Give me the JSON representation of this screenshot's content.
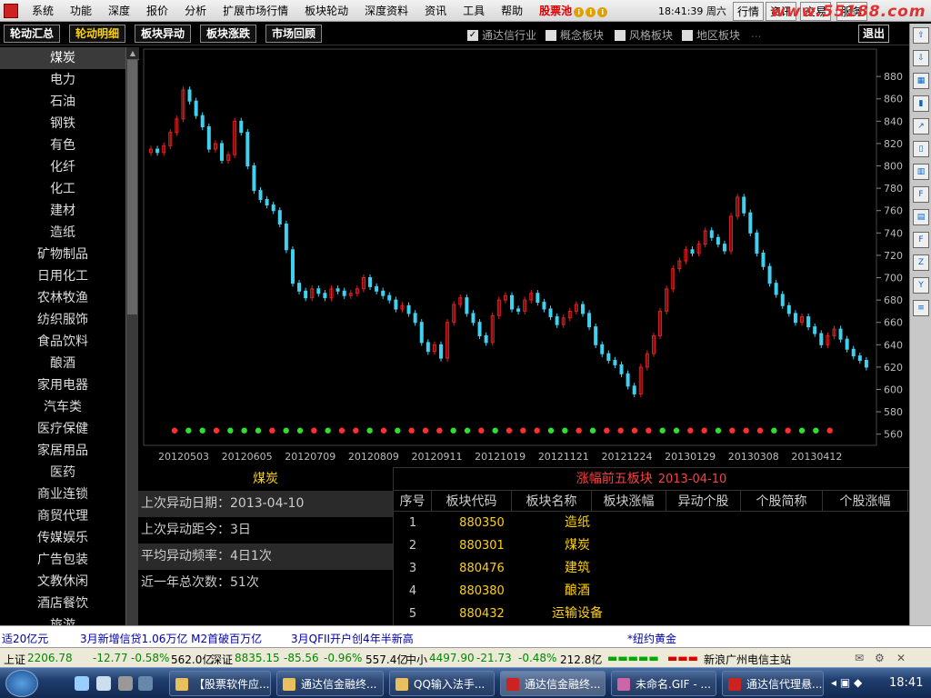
{
  "menubar": {
    "items": [
      "系统",
      "功能",
      "深度",
      "报价",
      "分析",
      "扩展市场行情",
      "板块轮动",
      "深度资料",
      "资讯",
      "工具",
      "帮助"
    ],
    "stock_pool": "股票池",
    "clock": "18:41:39 周六",
    "right_buttons": [
      "行情",
      "资讯",
      "交易",
      "服务"
    ],
    "watermark": "www.55188.com"
  },
  "tabs": [
    "轮动汇总",
    "轮动明细",
    "板块异动",
    "板块涨跌",
    "市场回顾"
  ],
  "active_tab": 1,
  "filters": [
    {
      "label": "通达信行业",
      "checked": true
    },
    {
      "label": "概念板块",
      "checked": false
    },
    {
      "label": "风格板块",
      "checked": false
    },
    {
      "label": "地区板块",
      "checked": false
    }
  ],
  "filter_extra": "...",
  "exit_label": "退出",
  "sidebar": {
    "items": [
      "煤炭",
      "电力",
      "石油",
      "钢铁",
      "有色",
      "化纤",
      "化工",
      "建材",
      "造纸",
      "矿物制品",
      "日用化工",
      "农林牧渔",
      "纺织服饰",
      "食品饮料",
      "酿酒",
      "家用电器",
      "汽车类",
      "医疗保健",
      "家居用品",
      "医药",
      "商业连锁",
      "商贸代理",
      "传媒娱乐",
      "广告包装",
      "文教休闲",
      "酒店餐饮",
      "旅游"
    ],
    "selected": 0
  },
  "chart_data": {
    "type": "candlestick",
    "title": "",
    "ylim": [
      550,
      885
    ],
    "yticks": [
      880,
      860,
      840,
      820,
      800,
      780,
      760,
      740,
      720,
      700,
      680,
      660,
      640,
      620,
      600,
      580,
      560
    ],
    "xticks": [
      "20120503",
      "20120605",
      "20120709",
      "20120809",
      "20120911",
      "20121019",
      "20121121",
      "20121224",
      "20130129",
      "20130308",
      "20130412"
    ],
    "close_path": [
      815,
      812,
      818,
      830,
      842,
      868,
      858,
      845,
      835,
      815,
      820,
      805,
      810,
      840,
      830,
      800,
      778,
      770,
      765,
      760,
      748,
      725,
      695,
      688,
      682,
      690,
      686,
      682,
      690,
      688,
      684,
      686,
      690,
      700,
      692,
      688,
      684,
      680,
      672,
      675,
      668,
      660,
      642,
      634,
      640,
      628,
      660,
      676,
      682,
      668,
      660,
      648,
      642,
      666,
      680,
      684,
      672,
      670,
      680,
      686,
      678,
      672,
      665,
      658,
      664,
      670,
      676,
      668,
      656,
      640,
      632,
      626,
      622,
      614,
      603,
      596,
      620,
      632,
      648,
      670,
      690,
      708,
      715,
      725,
      722,
      730,
      742,
      736,
      730,
      724,
      755,
      772,
      758,
      740,
      722,
      710,
      695,
      685,
      675,
      668,
      660,
      665,
      656,
      650,
      640,
      648,
      654,
      645,
      636,
      630,
      626,
      620
    ],
    "annotation_marks": [
      "red",
      "green",
      "green",
      "red",
      "green",
      "green",
      "green",
      "red",
      "green",
      "green",
      "red",
      "green",
      "red",
      "red",
      "green",
      "red",
      "green",
      "red",
      "red",
      "red",
      "green",
      "green",
      "red",
      "green",
      "red",
      "red",
      "red",
      "green",
      "green",
      "red",
      "green",
      "red",
      "red",
      "red",
      "red",
      "green",
      "green",
      "red",
      "red",
      "green",
      "red",
      "red",
      "red",
      "green",
      "red",
      "green",
      "green",
      "red"
    ],
    "up_color": "#e02020",
    "down_color": "#40d0f0"
  },
  "info": {
    "title": "煤炭",
    "rows": [
      {
        "label": "上次异动日期：",
        "value": "2013-04-10"
      },
      {
        "label": "上次异动距今：",
        "value": "3日"
      },
      {
        "label": "平均异动频率：",
        "value": "4日1次"
      },
      {
        "label": "近一年总次数：",
        "value": "51次"
      }
    ]
  },
  "top5": {
    "title": "涨幅前五板块",
    "date": "2013-04-10",
    "headers": [
      "序号",
      "板块代码",
      "板块名称",
      "板块涨幅",
      "异动个股",
      "个股简称",
      "个股涨幅"
    ],
    "rows": [
      {
        "no": "1",
        "code": "880350",
        "name": "造纸"
      },
      {
        "no": "2",
        "code": "880301",
        "name": "煤炭"
      },
      {
        "no": "3",
        "code": "880476",
        "name": "建筑"
      },
      {
        "no": "4",
        "code": "880380",
        "name": "酿酒"
      },
      {
        "no": "5",
        "code": "880432",
        "name": "运输设备"
      }
    ]
  },
  "ticker": [
    "适20亿元",
    "3月新增信贷1.06万亿 M2首破百万亿",
    "3月QFII开户创4年半新高",
    "*纽约黄金"
  ],
  "status": {
    "sh_label": "上证",
    "sh_val": "2206.78",
    "sh_chg": "-12.77",
    "sh_pct": "-0.58%",
    "sh_amt": "562.0亿",
    "sz_label": "深证",
    "sz_val": "8835.15",
    "sz_chg": "-85.56",
    "sz_pct": "-0.96%",
    "sz_amt": "557.4亿",
    "zx_label": "中小",
    "zx_val": "4497.90",
    "zx_chg": "-21.73",
    "zx_pct": "-0.48%",
    "zx_amt": "212.8亿",
    "server": "新浪广州电信主站"
  },
  "taskbar": {
    "items": [
      "【股票软件应...",
      "通达信金融终...",
      "QQ输入法手...",
      "通达信金融终...",
      "未命名.GIF - ...",
      "通达信代理悬..."
    ],
    "active": 3,
    "time": "18:41"
  }
}
